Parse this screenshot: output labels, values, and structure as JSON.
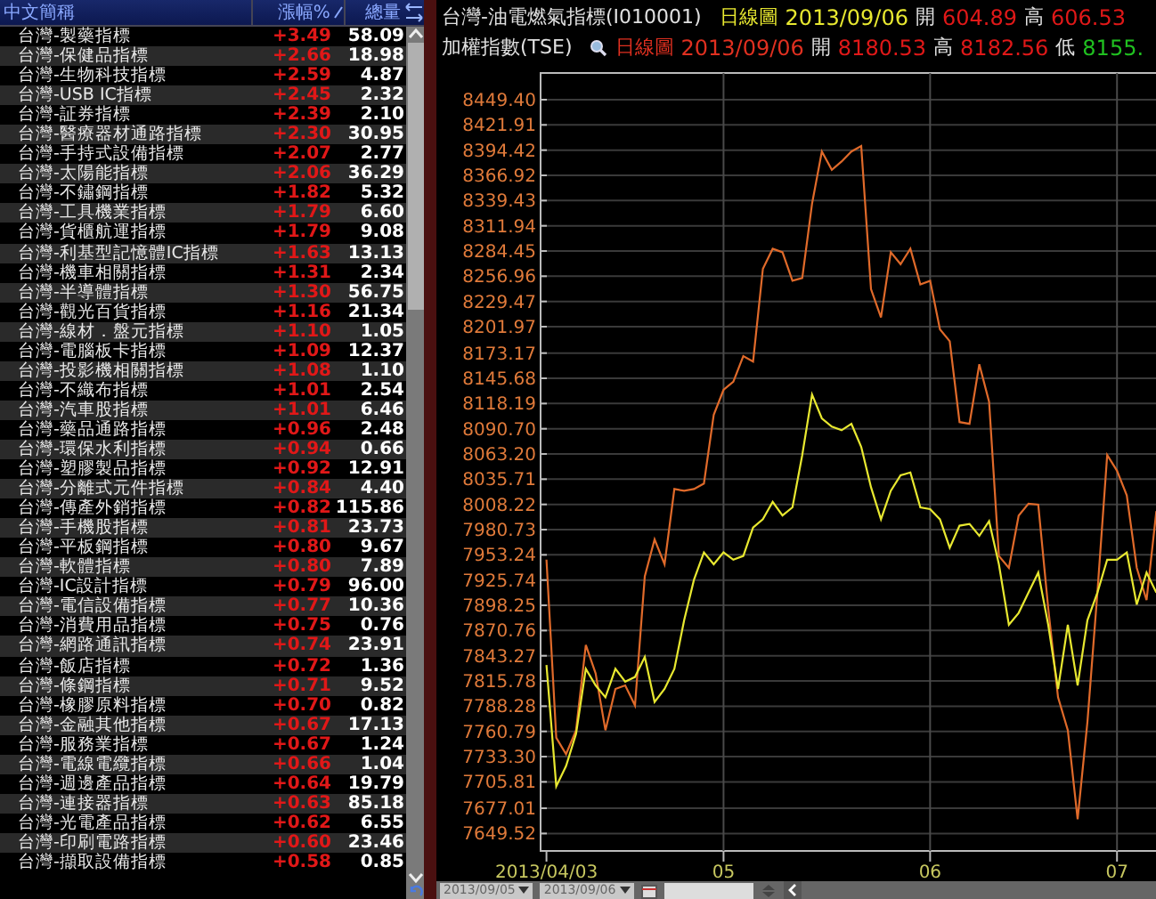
{
  "quote_list": {
    "columns": [
      {
        "label": "中文簡稱"
      },
      {
        "label": "漲幅%"
      },
      {
        "label": "總量"
      }
    ],
    "rows": [
      {
        "name": "台灣-製藥指標",
        "change": "+3.49",
        "volume": "58.09"
      },
      {
        "name": "台灣-保健品指標",
        "change": "+2.66",
        "volume": "18.98"
      },
      {
        "name": "台灣-生物科技指標",
        "change": "+2.59",
        "volume": "4.87"
      },
      {
        "name": "台灣-USB IC指標",
        "change": "+2.45",
        "volume": "2.32"
      },
      {
        "name": "台灣-証券指標",
        "change": "+2.39",
        "volume": "2.10"
      },
      {
        "name": "台灣-醫療器材通路指標",
        "change": "+2.30",
        "volume": "30.95"
      },
      {
        "name": "台灣-手持式設備指標",
        "change": "+2.07",
        "volume": "2.77"
      },
      {
        "name": "台灣-太陽能指標",
        "change": "+2.06",
        "volume": "36.29"
      },
      {
        "name": "台灣-不鏽鋼指標",
        "change": "+1.82",
        "volume": "5.32"
      },
      {
        "name": "台灣-工具機業指標",
        "change": "+1.79",
        "volume": "6.60"
      },
      {
        "name": "台灣-貨櫃航運指標",
        "change": "+1.79",
        "volume": "9.08"
      },
      {
        "name": "台灣-利基型記憶體IC指標",
        "change": "+1.63",
        "volume": "13.13"
      },
      {
        "name": "台灣-機車相關指標",
        "change": "+1.31",
        "volume": "2.34"
      },
      {
        "name": "台灣-半導體指標",
        "change": "+1.30",
        "volume": "56.75"
      },
      {
        "name": "台灣-觀光百貨指標",
        "change": "+1.16",
        "volume": "21.34"
      },
      {
        "name": "台灣-線材．盤元指標",
        "change": "+1.10",
        "volume": "1.05"
      },
      {
        "name": "台灣-電腦板卡指標",
        "change": "+1.09",
        "volume": "12.37"
      },
      {
        "name": "台灣-投影機相關指標",
        "change": "+1.08",
        "volume": "1.10"
      },
      {
        "name": "台灣-不織布指標",
        "change": "+1.01",
        "volume": "2.54"
      },
      {
        "name": "台灣-汽車股指標",
        "change": "+1.01",
        "volume": "6.46"
      },
      {
        "name": "台灣-藥品通路指標",
        "change": "+0.96",
        "volume": "2.48"
      },
      {
        "name": "台灣-環保水利指標",
        "change": "+0.94",
        "volume": "0.66"
      },
      {
        "name": "台灣-塑膠製品指標",
        "change": "+0.92",
        "volume": "12.91"
      },
      {
        "name": "台灣-分離式元件指標",
        "change": "+0.84",
        "volume": "4.40"
      },
      {
        "name": "台灣-傳產外銷指標",
        "change": "+0.82",
        "volume": "115.86"
      },
      {
        "name": "台灣-手機股指標",
        "change": "+0.81",
        "volume": "23.73"
      },
      {
        "name": "台灣-平板鋼指標",
        "change": "+0.80",
        "volume": "9.67"
      },
      {
        "name": "台灣-軟體指標",
        "change": "+0.80",
        "volume": "7.89"
      },
      {
        "name": "台灣-IC設計指標",
        "change": "+0.79",
        "volume": "96.00"
      },
      {
        "name": "台灣-電信設備指標",
        "change": "+0.77",
        "volume": "10.36"
      },
      {
        "name": "台灣-消費用品指標",
        "change": "+0.75",
        "volume": "0.76"
      },
      {
        "name": "台灣-網路通訊指標",
        "change": "+0.74",
        "volume": "23.91"
      },
      {
        "name": "台灣-飯店指標",
        "change": "+0.72",
        "volume": "1.36"
      },
      {
        "name": "台灣-條鋼指標",
        "change": "+0.71",
        "volume": "9.52"
      },
      {
        "name": "台灣-橡膠原料指標",
        "change": "+0.70",
        "volume": "0.82"
      },
      {
        "name": "台灣-金融其他指標",
        "change": "+0.67",
        "volume": "17.13"
      },
      {
        "name": "台灣-服務業指標",
        "change": "+0.67",
        "volume": "1.24"
      },
      {
        "name": "台灣-電線電纜指標",
        "change": "+0.66",
        "volume": "1.04"
      },
      {
        "name": "台灣-週邊產品指標",
        "change": "+0.64",
        "volume": "19.79"
      },
      {
        "name": "台灣-連接器指標",
        "change": "+0.63",
        "volume": "85.18"
      },
      {
        "name": "台灣-光電產品指標",
        "change": "+0.62",
        "volume": "6.55"
      },
      {
        "name": "台灣-印刷電路指標",
        "change": "+0.60",
        "volume": "23.46"
      },
      {
        "name": "台灣-擷取設備指標",
        "change": "+0.58",
        "volume": "0.85"
      }
    ]
  },
  "chart_panel": {
    "header_lines": [
      {
        "title": "台灣-油電燃氣指標(I010001)",
        "period": "日線圖",
        "date": "2013/09/06",
        "color": "#e8e830",
        "open_label": "開",
        "open": "604.89",
        "high_label": "高",
        "high": "606.53"
      },
      {
        "title": "加權指數(TSE)",
        "period": "日線圖",
        "date": "2013/09/06",
        "color": "#e03020",
        "open_label": "開",
        "open": "8180.53",
        "high_label": "高",
        "high": "8182.56",
        "low_label": "低",
        "low": "8155."
      }
    ],
    "chart_data": {
      "type": "line",
      "categories": [
        "2013/04/03",
        null,
        null,
        null,
        null,
        null,
        null,
        null,
        null,
        null,
        null,
        null,
        null,
        null,
        null,
        null,
        null,
        null,
        "05",
        null,
        null,
        null,
        null,
        null,
        null,
        null,
        null,
        null,
        null,
        null,
        null,
        null,
        null,
        null,
        null,
        null,
        null,
        null,
        null,
        "06",
        null,
        null,
        null,
        null,
        null,
        null,
        null,
        null,
        null,
        null,
        null,
        null,
        null,
        null,
        null,
        null,
        null,
        null,
        "07",
        null,
        null,
        null,
        null
      ],
      "series": [
        {
          "color": "#e06a2a",
          "values": [
            7948,
            7754,
            7736,
            7762,
            7855,
            7824,
            7762,
            7807,
            7811,
            7789,
            7930,
            7970,
            7943,
            8025,
            8023,
            8025,
            8031,
            8106,
            8133,
            8142,
            8170,
            8164,
            8265,
            8287,
            8283,
            8252,
            8255,
            8336,
            8393,
            8373,
            8382,
            8393,
            8399,
            8243,
            8212,
            8283,
            8270,
            8287,
            8248,
            8252,
            8199,
            8186,
            8098,
            8096,
            8161,
            8120,
            7952,
            7939,
            7996,
            8009,
            8008,
            7895,
            7798,
            7762,
            7665,
            7771,
            7912,
            8062,
            8045,
            8018,
            7939,
            7904,
            8001
          ]
        },
        {
          "color": "#e8e830",
          "values": [
            7833,
            7701,
            7723,
            7758,
            7829,
            7811,
            7798,
            7829,
            7815,
            7820,
            7842,
            7793,
            7807,
            7829,
            7882,
            7926,
            7956,
            7943,
            7956,
            7948,
            7952,
            7983,
            7992,
            8011,
            7996,
            8005,
            8062,
            8128,
            8102,
            8093,
            8089,
            8096,
            8071,
            8027,
            7992,
            8023,
            8040,
            8043,
            8005,
            8003,
            7992,
            7961,
            7985,
            7987,
            7974,
            7990,
            7943,
            7877,
            7890,
            7912,
            7934,
            7877,
            7807,
            7877,
            7811,
            7882,
            7912,
            7948,
            7948,
            7956,
            7899,
            7934,
            7912
          ]
        }
      ],
      "ylim": [
        7630.5,
        8478.5
      ],
      "grid": true,
      "yticks": [
        {
          "value": 8449.4,
          "label": "8449.40"
        },
        {
          "value": 8421.91,
          "label": "8421.91"
        },
        {
          "value": 8394.42,
          "label": "8394.42"
        },
        {
          "value": 8366.92,
          "label": "8366.92"
        },
        {
          "value": 8339.43,
          "label": "8339.43"
        },
        {
          "value": 8311.94,
          "label": "8311.94"
        },
        {
          "value": 8284.45,
          "label": "8284.45"
        },
        {
          "value": 8256.96,
          "label": "8256.96"
        },
        {
          "value": 8229.47,
          "label": "8229.47"
        },
        {
          "value": 8201.97,
          "label": "8201.97"
        },
        {
          "value": 8173.17,
          "label": "8173.17"
        },
        {
          "value": 8145.68,
          "label": "8145.68"
        },
        {
          "value": 8118.19,
          "label": "8118.19"
        },
        {
          "value": 8090.7,
          "label": "8090.70"
        },
        {
          "value": 8063.2,
          "label": "8063.20"
        },
        {
          "value": 8035.71,
          "label": "8035.71"
        },
        {
          "value": 8008.22,
          "label": "8008.22"
        },
        {
          "value": 7980.73,
          "label": "7980.73"
        },
        {
          "value": 7953.24,
          "label": "7953.24"
        },
        {
          "value": 7925.74,
          "label": "7925.74"
        },
        {
          "value": 7898.25,
          "label": "7898.25"
        },
        {
          "value": 7870.76,
          "label": "7870.76"
        },
        {
          "value": 7843.27,
          "label": "7843.27"
        },
        {
          "value": 7815.78,
          "label": "7815.78"
        },
        {
          "value": 7788.28,
          "label": "7788.28"
        },
        {
          "value": 7760.79,
          "label": "7760.79"
        },
        {
          "value": 7733.3,
          "label": "7733.30"
        },
        {
          "value": 7705.81,
          "label": "7705.81"
        },
        {
          "value": 7677.01,
          "label": "7677.01"
        },
        {
          "value": 7649.52,
          "label": "7649.52"
        }
      ]
    }
  },
  "toolbar": {
    "start_date": "2013/09/05",
    "end_date": "2013/09/06"
  }
}
